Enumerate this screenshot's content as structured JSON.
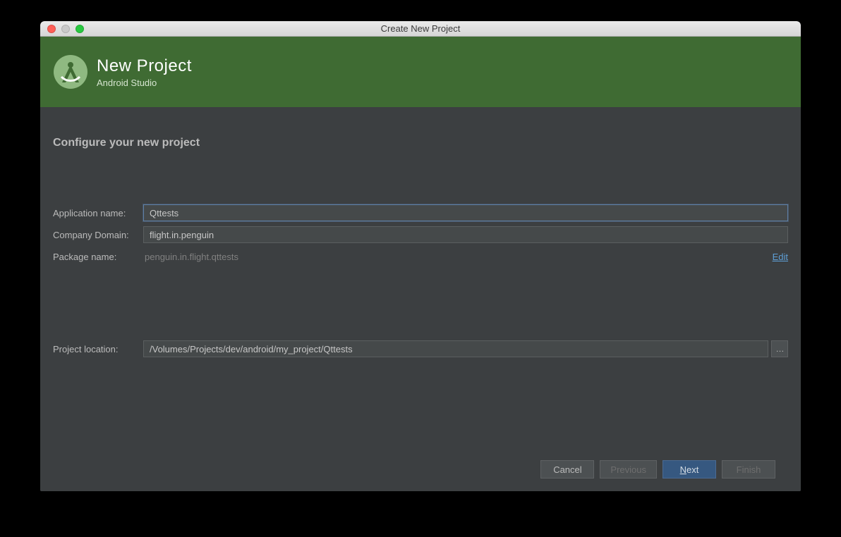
{
  "window": {
    "title": "Create New Project"
  },
  "header": {
    "title": "New Project",
    "subtitle": "Android Studio"
  },
  "section": {
    "title": "Configure your new project"
  },
  "form": {
    "app_name_label": "Application name:",
    "app_name_value": "Qttests",
    "company_domain_label": "Company Domain:",
    "company_domain_value": "flight.in.penguin",
    "package_name_label": "Package name:",
    "package_name_value": "penguin.in.flight.qttests",
    "edit_link": "Edit",
    "project_location_label": "Project location:",
    "project_location_value": "/Volumes/Projects/dev/android/my_project/Qttests",
    "browse_icon": "…"
  },
  "buttons": {
    "cancel": "Cancel",
    "previous": "Previous",
    "next_prefix": "N",
    "next_suffix": "ext",
    "finish": "Finish"
  },
  "colors": {
    "header_bg": "#3f6b33",
    "body_bg": "#3c3f41",
    "primary_btn": "#365880"
  }
}
